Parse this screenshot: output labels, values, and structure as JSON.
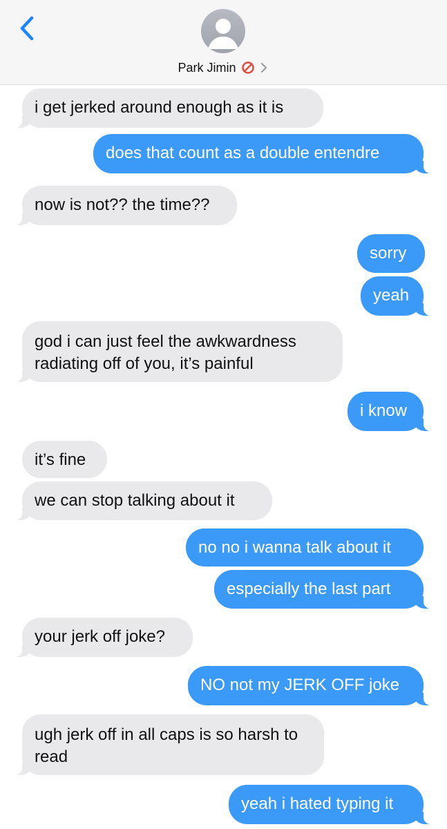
{
  "header": {
    "contact_name": "Park Jimin",
    "colors": {
      "back": "#1b84ff",
      "no_icon": "#e44b3f",
      "chevron": "#9b9ba1"
    }
  },
  "messages": [
    {
      "sender": "incoming",
      "text": "i get jerked around enough as it is"
    },
    {
      "sender": "outgoing",
      "text": "does that count as a double entendre"
    },
    {
      "sender": "incoming",
      "text": "now is not?? the time??"
    },
    {
      "sender": "outgoing",
      "text": "sorry"
    },
    {
      "sender": "outgoing",
      "text": "yeah"
    },
    {
      "sender": "incoming",
      "text": "god i can just feel the awkwardness radiating off of you, it’s painful"
    },
    {
      "sender": "outgoing",
      "text": "i know"
    },
    {
      "sender": "incoming",
      "text": "it’s fine"
    },
    {
      "sender": "incoming",
      "text": "we can stop talking about it"
    },
    {
      "sender": "outgoing",
      "text": "no no i wanna talk about it"
    },
    {
      "sender": "outgoing",
      "text": "especially the last part"
    },
    {
      "sender": "incoming",
      "text": "your jerk off joke?"
    },
    {
      "sender": "outgoing",
      "text": "NO not my JERK OFF joke"
    },
    {
      "sender": "incoming",
      "text": "ugh jerk off in all caps is so harsh to read"
    },
    {
      "sender": "outgoing",
      "text": "yeah i hated typing it"
    }
  ]
}
